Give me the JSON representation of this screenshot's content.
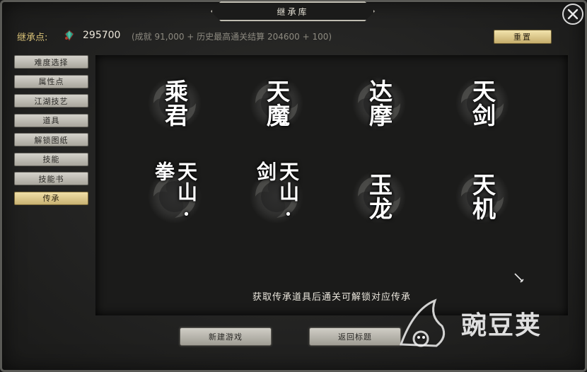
{
  "window": {
    "title": "继承库"
  },
  "points": {
    "label": "继承点:",
    "value": "295700",
    "formula": "(成就 91,000 + 历史最高通关结算 204600 + 100)",
    "icon": "gem-icon"
  },
  "reset_button": "重置",
  "sidebar": {
    "items": [
      {
        "label": "难度选择",
        "active": false
      },
      {
        "label": "属性点",
        "active": false
      },
      {
        "label": "江湖技艺",
        "active": false
      },
      {
        "label": "道具",
        "active": false
      },
      {
        "label": "解锁图纸",
        "active": false
      },
      {
        "label": "技能",
        "active": false
      },
      {
        "label": "技能书",
        "active": false
      },
      {
        "label": "传承",
        "active": true
      }
    ]
  },
  "inheritances": [
    {
      "name": "乘君"
    },
    {
      "name": "天魔"
    },
    {
      "name": "达摩"
    },
    {
      "name": "天剑"
    },
    {
      "name": "天山·拳"
    },
    {
      "name": "天山·剑"
    },
    {
      "name": "玉龙"
    },
    {
      "name": "天机"
    }
  ],
  "hint": "获取传承道具后通关可解锁对应传承",
  "bottom_buttons": {
    "new_game": "新建游戏",
    "back_to_title": "返回标题"
  },
  "watermark": {
    "text": "豌豆荚"
  },
  "colors": {
    "accent_gold": "#d8c177",
    "active_tab": "#e6d393"
  }
}
